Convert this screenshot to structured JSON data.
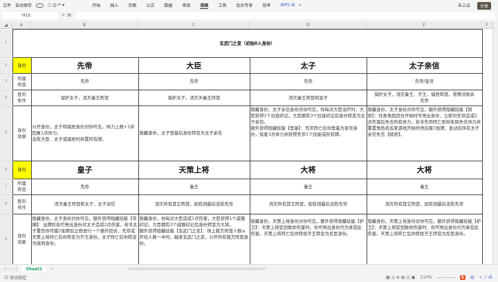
{
  "menubar": {
    "file": "文件",
    "autosave": "自动保存",
    "items": [
      "开始",
      "插入",
      "页面",
      "公式",
      "数据",
      "审阅",
      "视图",
      "工具",
      "会员专享",
      "效率"
    ],
    "active": "视图",
    "wps_ai": "WPS AI",
    "cloud": "未上云",
    "share": "分享"
  },
  "formula": {
    "cell_ref": "H15",
    "fx": "fx",
    "value": ""
  },
  "columns": [
    "A",
    "B",
    "C",
    "D",
    "E",
    "F"
  ],
  "sheet": {
    "title": "玄武门之变（初始8人身份）",
    "labels": {
      "identity": "身份",
      "faction": "所属\n阵营",
      "victory": "胜利\n条件",
      "effect": "身份\n效果"
    },
    "block1": [
      {
        "name": "先帝",
        "faction": "先帝",
        "victory": "保护太子，消灭秦王阵营",
        "effect": "公开身份，太子和储君身份对你可见，体力上限+1并回复1点体力。\n击败大臣、太子或储君时弃置所有牌。"
      },
      {
        "name": "大臣",
        "faction": "先帝",
        "victory": "保护太子，消灭天秦王阵营",
        "effect": "隐藏身份，太子登基后身份转变为太子亲信"
      },
      {
        "name": "太子",
        "faction": "先帝",
        "victory": "消灭秦王阵营和皇子",
        "effect": "隐藏身份，太子亲信身份对你可见，你每对大臣治疗时，大臣获得1个拉拢印记，大臣拥有3个拉拢印记后身份转变为太子亲信。\n额外获得隐藏技能【登基】：先帝阵亡后你登基为皇帝身份，恢复3点体力并获得先帝1个技能或所有牌。"
      },
      {
        "name": "太子亲信",
        "faction": "先帝/皇帝",
        "victory": "保护太子，消灭秦王、齐王、储君阵营，视情况刺杀先帝",
        "effect": "隐藏身份，太子身份对你可见，额外获得隐藏技能【弑君】：任意角色回合开始时可亮出身份，立即对先帝造成2点伤害后失去所有体力，若令先帝阵亡则你免除失去体力并重置角色状态至游戏开始时然后摸3张牌，发动后所有太子亲信失去【弑君】。"
      }
    ],
    "block2": [
      {
        "name": "皇子",
        "faction": "先帝",
        "victory": "消灭秦王阵营和太子、太子亲信",
        "effect": "隐藏身份，太子身份对你可见，额外获得隐藏技能【夺嫡】：出牌阶段可亮出身份对太子造成2点伤害，若令太子重伤你可摸2张牌后立即进行一个额外回合，先帝或天策上将阵亡后你转变为齐王身份，太子阵亡后你转变为储君身份。"
      },
      {
        "name": "天策上将",
        "faction": "秦王",
        "victory": "消灭所有其它阵营，如有则最后击败先帝",
        "effect": "隐藏身份，你每对大臣造成1点伤害，大臣获得1个威慑印记，大臣拥有3个威慑印记后身份转变为大将。\n额外获得隐藏技能【玄武门之变】：场上我方阵营人数≥开局人数一半时，触发玄武门之变，公开所有我方阵营身份。"
      },
      {
        "name": "大将",
        "faction": "秦王",
        "victory": "消灭所有其它阵营，如有则最后击败先帝",
        "effect": "隐藏身份，天策上将身份对你可见，额外获得隐藏技能【护卫】：天策上将受到致命伤害时，你可亮出身份代为承受此伤害。天策上将阵亡后你转投齐王转变为反臣身份。"
      },
      {
        "name": "大将",
        "faction": "秦王",
        "victory": "消灭所有其它阵营，如有则最后击败先帝",
        "effect": "隐藏身份，天策上将身份对你可见，额外获得隐藏技能【护卫】：天策上将受到致命伤害时，你可亮出身份代为承受此伤害。天策上将阵亡后你转投齐王转变为反臣身份。"
      }
    ]
  },
  "tabs": {
    "active": "Sheet1",
    "add": "+"
  },
  "status": {
    "text": "滚动锁定",
    "zoom": "110%",
    "ime": "中"
  },
  "colors": {
    "identity_label_bg": "#ffff00",
    "share_bg": "#5c5346",
    "sheet_tab": "#1a9e5c"
  }
}
